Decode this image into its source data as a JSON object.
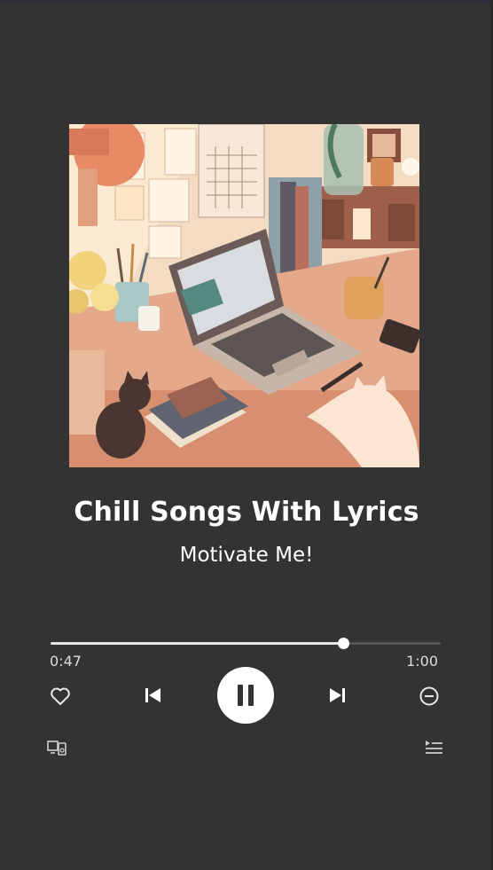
{
  "song": {
    "title": "Chill Songs With Lyrics",
    "artist": "Motivate Me!"
  },
  "progress": {
    "elapsed": "0:47",
    "duration": "1:00",
    "fraction": 0.75
  },
  "controls": {
    "like": "heart-icon",
    "previous": "skip-previous-icon",
    "play_pause": "pause-icon",
    "next": "skip-next-icon",
    "remove": "minus-circle-icon",
    "devices": "devices-icon",
    "queue": "queue-icon"
  },
  "colors": {
    "background": "#333333",
    "text": "#ffffff",
    "accent": "#ffffff"
  }
}
